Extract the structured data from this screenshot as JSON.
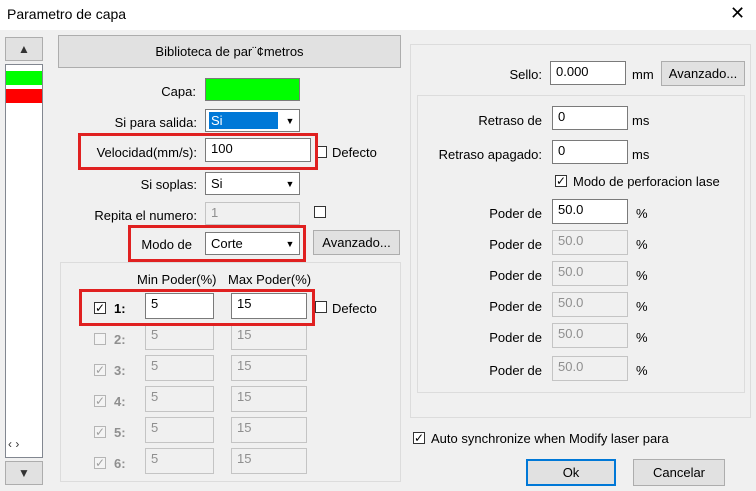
{
  "window": {
    "title": "Parametro de capa",
    "close_glyph": "✕"
  },
  "left_strip": {
    "scroll_up_glyph": "▲",
    "scroll_down_glyph": "▼",
    "lr_glyph": "‹ ›",
    "layers": [
      {
        "color": "#00ff00"
      },
      {
        "color": "#ff0000"
      }
    ]
  },
  "library_button": "Biblioteca de par¨¢metros",
  "capa": {
    "label": "Capa:",
    "color": "#00ff00"
  },
  "salida": {
    "label": "Si para salida:",
    "value": "Si"
  },
  "velocidad": {
    "label": "Velocidad(mm/s):",
    "value": "100",
    "default_label": "Defecto"
  },
  "soplas": {
    "label": "Si soplas:",
    "value": "Si"
  },
  "repita": {
    "label": "Repita el numero:",
    "value": "1"
  },
  "modo": {
    "label": "Modo de",
    "value": "Corte",
    "advanced_button": "Avanzado..."
  },
  "power": {
    "min_header": "Min Poder(%)",
    "max_header": "Max Poder(%)",
    "default_label": "Defecto",
    "rows": [
      {
        "label": "1:",
        "min": "5",
        "max": "15",
        "checked": true,
        "enabled": true
      },
      {
        "label": "2:",
        "min": "5",
        "max": "15",
        "checked": false,
        "enabled": false
      },
      {
        "label": "3:",
        "min": "5",
        "max": "15",
        "checked": true,
        "enabled": false
      },
      {
        "label": "4:",
        "min": "5",
        "max": "15",
        "checked": true,
        "enabled": false
      },
      {
        "label": "5:",
        "min": "5",
        "max": "15",
        "checked": true,
        "enabled": false
      },
      {
        "label": "6:",
        "min": "5",
        "max": "15",
        "checked": true,
        "enabled": false
      }
    ]
  },
  "sello": {
    "label": "Sello:",
    "value": "0.000",
    "unit": "mm",
    "advanced_button": "Avanzado..."
  },
  "retraso": {
    "label": "Retraso de",
    "value": "0",
    "unit": "ms"
  },
  "retraso_apagado": {
    "label": "Retraso apagado:",
    "value": "0",
    "unit": "ms"
  },
  "perforacion": {
    "label": "Modo de perforacion lase",
    "checked": true
  },
  "poder_rows": [
    {
      "label": "Poder de",
      "value": "50.0",
      "unit": "%",
      "enabled": true
    },
    {
      "label": "Poder de",
      "value": "50.0",
      "unit": "%",
      "enabled": false
    },
    {
      "label": "Poder de",
      "value": "50.0",
      "unit": "%",
      "enabled": false
    },
    {
      "label": "Poder de",
      "value": "50.0",
      "unit": "%",
      "enabled": false
    },
    {
      "label": "Poder de",
      "value": "50.0",
      "unit": "%",
      "enabled": false
    },
    {
      "label": "Poder de",
      "value": "50.0",
      "unit": "%",
      "enabled": false
    }
  ],
  "auto_sync": {
    "label": "Auto synchronize when Modify laser para",
    "checked": true
  },
  "ok_button": "Ok",
  "cancel_button": "Cancelar",
  "check_glyph": "✓"
}
